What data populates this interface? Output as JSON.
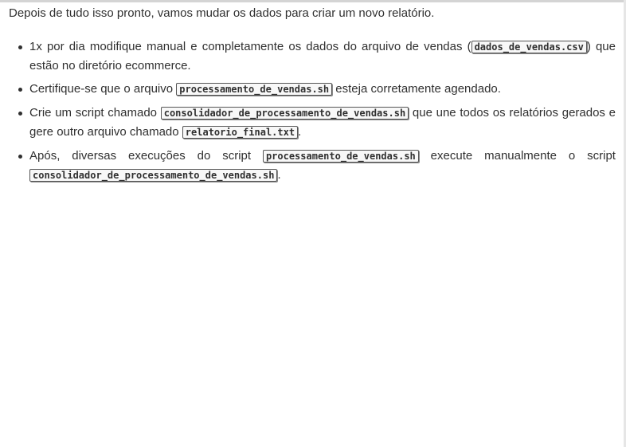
{
  "intro": "Depois de tudo isso pronto, vamos mudar os dados para criar um novo relatório.",
  "items": [
    {
      "t1": "1x por dia modifique manual e completamente os dados do arquivo de vendas (",
      "c1": "dados_de_vendas.csv",
      "t2": ") que estão no diretório ecommerce."
    },
    {
      "t1": "Certifique-se que o arquivo ",
      "c1": "processamento_de_vendas.sh",
      "t2": " esteja corretamente agendado."
    },
    {
      "t1": "Crie um script chamado ",
      "c1": "consolidador_de_processamento_de_vendas.sh",
      "t2": " que une todos os relatórios gerados e gere outro arquivo chamado ",
      "c2": "relatorio_final.txt",
      "t3": "."
    },
    {
      "t1": "Após, diversas execuções do script ",
      "c1": "processamento_de_vendas.sh",
      "t2": " execute manualmente o script ",
      "c2": "consolidador_de_processamento_de_vendas.sh",
      "t3": "."
    }
  ]
}
